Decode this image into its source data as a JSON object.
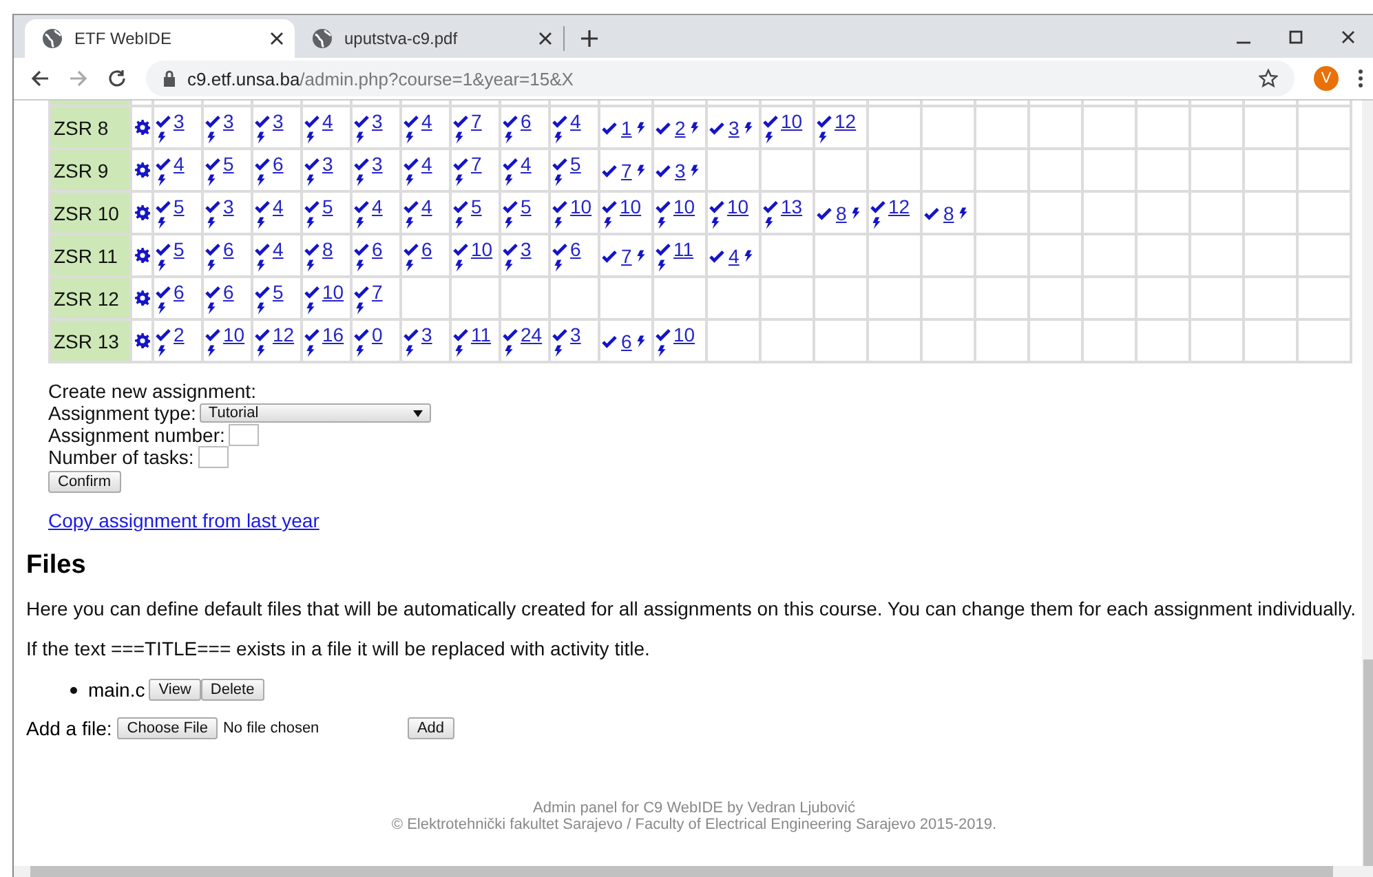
{
  "browser": {
    "tabs": [
      {
        "title": "ETF WebIDE",
        "selected": true
      },
      {
        "title": "uputstva-c9.pdf",
        "selected": false
      }
    ],
    "url_host": "c9.etf.unsa.ba",
    "url_path": "/admin.php?course=1&year=15&X",
    "avatar": "V"
  },
  "table": {
    "rows": [
      {
        "name": "ZSR 8",
        "cells": [
          {
            "kind": "stacked",
            "value": "3"
          },
          {
            "kind": "stacked",
            "value": "3"
          },
          {
            "kind": "stacked",
            "value": "3"
          },
          {
            "kind": "stacked",
            "value": "4"
          },
          {
            "kind": "stacked",
            "value": "3"
          },
          {
            "kind": "stacked",
            "value": "4"
          },
          {
            "kind": "stacked",
            "value": "7"
          },
          {
            "kind": "stacked",
            "value": "6"
          },
          {
            "kind": "stacked",
            "value": "4"
          },
          {
            "kind": "inline",
            "value": "1"
          },
          {
            "kind": "inline",
            "value": "2"
          },
          {
            "kind": "inline",
            "value": "3"
          },
          {
            "kind": "stacked",
            "value": "10"
          },
          {
            "kind": "stacked",
            "value": "12"
          }
        ]
      },
      {
        "name": "ZSR 9",
        "cells": [
          {
            "kind": "stacked",
            "value": "4"
          },
          {
            "kind": "stacked",
            "value": "5"
          },
          {
            "kind": "stacked",
            "value": "6"
          },
          {
            "kind": "stacked",
            "value": "3"
          },
          {
            "kind": "stacked",
            "value": "3"
          },
          {
            "kind": "stacked",
            "value": "4"
          },
          {
            "kind": "stacked",
            "value": "7"
          },
          {
            "kind": "stacked",
            "value": "4"
          },
          {
            "kind": "stacked",
            "value": "5"
          },
          {
            "kind": "inline",
            "value": "7"
          },
          {
            "kind": "inline",
            "value": "3"
          }
        ]
      },
      {
        "name": "ZSR 10",
        "cells": [
          {
            "kind": "stacked",
            "value": "5"
          },
          {
            "kind": "stacked",
            "value": "3"
          },
          {
            "kind": "stacked",
            "value": "4"
          },
          {
            "kind": "stacked",
            "value": "5"
          },
          {
            "kind": "stacked",
            "value": "4"
          },
          {
            "kind": "stacked",
            "value": "4"
          },
          {
            "kind": "stacked",
            "value": "5"
          },
          {
            "kind": "stacked",
            "value": "5"
          },
          {
            "kind": "stacked",
            "value": "10"
          },
          {
            "kind": "stacked",
            "value": "10"
          },
          {
            "kind": "stacked",
            "value": "10"
          },
          {
            "kind": "stacked",
            "value": "10"
          },
          {
            "kind": "stacked",
            "value": "13"
          },
          {
            "kind": "inline",
            "value": "8"
          },
          {
            "kind": "stacked",
            "value": "12"
          },
          {
            "kind": "inline",
            "value": "8"
          }
        ]
      },
      {
        "name": "ZSR 11",
        "cells": [
          {
            "kind": "stacked",
            "value": "5"
          },
          {
            "kind": "stacked",
            "value": "6"
          },
          {
            "kind": "stacked",
            "value": "4"
          },
          {
            "kind": "stacked",
            "value": "8"
          },
          {
            "kind": "stacked",
            "value": "6"
          },
          {
            "kind": "stacked",
            "value": "6"
          },
          {
            "kind": "stacked",
            "value": "10"
          },
          {
            "kind": "stacked",
            "value": "3"
          },
          {
            "kind": "stacked",
            "value": "6"
          },
          {
            "kind": "inline",
            "value": "7"
          },
          {
            "kind": "stacked",
            "value": "11"
          },
          {
            "kind": "inline",
            "value": "4"
          }
        ]
      },
      {
        "name": "ZSR 12",
        "cells": [
          {
            "kind": "stacked",
            "value": "6"
          },
          {
            "kind": "stacked",
            "value": "6"
          },
          {
            "kind": "stacked",
            "value": "5"
          },
          {
            "kind": "stacked",
            "value": "10"
          },
          {
            "kind": "stacked",
            "value": "7"
          }
        ]
      },
      {
        "name": "ZSR 13",
        "cells": [
          {
            "kind": "stacked",
            "value": "2"
          },
          {
            "kind": "stacked",
            "value": "10"
          },
          {
            "kind": "stacked",
            "value": "12"
          },
          {
            "kind": "stacked",
            "value": "16"
          },
          {
            "kind": "stacked",
            "value": "0"
          },
          {
            "kind": "stacked",
            "value": "3"
          },
          {
            "kind": "stacked",
            "value": "11"
          },
          {
            "kind": "stacked",
            "value": "24"
          },
          {
            "kind": "stacked",
            "value": "3"
          },
          {
            "kind": "inline",
            "value": "6"
          },
          {
            "kind": "stacked",
            "value": "10"
          }
        ]
      }
    ]
  },
  "create_form": {
    "heading": "Create new assignment:",
    "type_label": "Assignment type:",
    "type_value": "Tutorial",
    "number_label": "Assignment number:",
    "tasks_label": "Number of tasks:",
    "confirm": "Confirm",
    "copy_link": "Copy assignment from last year"
  },
  "files": {
    "title": "Files",
    "intro": "Here you can define default files that will be automatically created for all assignments on this course. You can change them for each assignment individually.",
    "note": "If the text ===TITLE=== exists in a file it will be replaced with activity title.",
    "items": [
      {
        "name": "main.c",
        "buttons": [
          "View",
          "Delete"
        ]
      }
    ],
    "add_label": "Add a file:",
    "choose": "Choose File",
    "no_file": "No file chosen",
    "add": "Add"
  },
  "footer": [
    "Admin panel for C9 WebIDE by Vedran Ljubović",
    "© Elektrotehnički fakultet Sarajevo / Faculty of Electrical Engineering Sarajevo 2015-2019."
  ]
}
